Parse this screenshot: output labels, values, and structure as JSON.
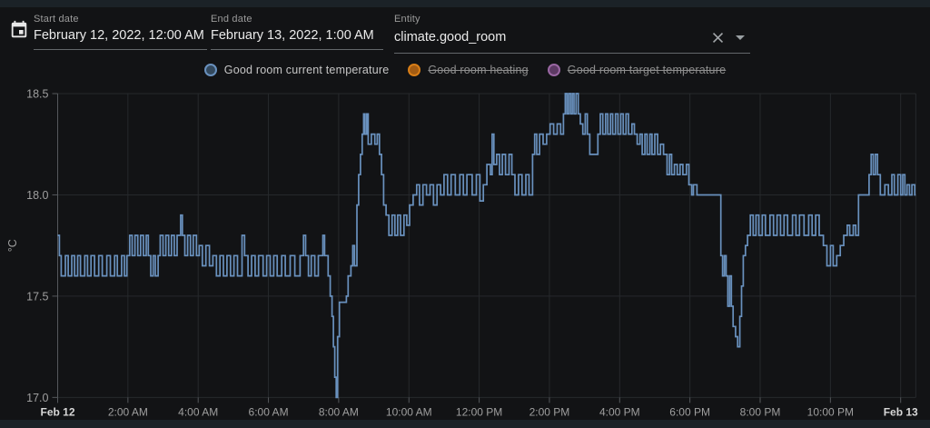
{
  "header": {
    "fields": [
      {
        "label": "Start date",
        "value": "February 12, 2022, 12:00 AM"
      },
      {
        "label": "End date",
        "value": "February 13, 2022, 1:00 AM"
      },
      {
        "label": "Entity",
        "value": "climate.good_room"
      }
    ]
  },
  "legend": [
    {
      "label": "Good room current temperature",
      "color": "#6991be",
      "fill": "#33495e",
      "active": true
    },
    {
      "label": "Good room heating",
      "color": "#d87e17",
      "fill": "#a35c13",
      "active": false
    },
    {
      "label": "Good room target temperature",
      "color": "#9a67a3",
      "fill": "#5d3a64",
      "active": false
    }
  ],
  "chart_data": {
    "type": "line",
    "line_style": "step-after",
    "series": [
      {
        "name": "Good room current temperature",
        "unit": "°C"
      }
    ],
    "ylabel": "°C",
    "ylim": [
      17.0,
      18.5
    ],
    "xlim_hours": [
      0,
      24.43
    ],
    "grid": true,
    "colors": {
      "line": "#6991be",
      "grid": "#26292c",
      "axis": "#55585c",
      "tick_label": "#9f9f9f",
      "tick_label_bold": "#d8d8d8"
    },
    "y_ticks": [
      {
        "value": 18.5,
        "label": "18.5"
      },
      {
        "value": 18.0,
        "label": "18.0"
      },
      {
        "value": 17.5,
        "label": "17.5"
      },
      {
        "value": 17.0,
        "label": "17.0"
      }
    ],
    "x_ticks": [
      {
        "hour": 0,
        "label": "Feb 12",
        "bold": true
      },
      {
        "hour": 2,
        "label": "2:00 AM",
        "bold": false
      },
      {
        "hour": 4,
        "label": "4:00 AM",
        "bold": false
      },
      {
        "hour": 6,
        "label": "6:00 AM",
        "bold": false
      },
      {
        "hour": 8,
        "label": "8:00 AM",
        "bold": false
      },
      {
        "hour": 10,
        "label": "10:00 AM",
        "bold": false
      },
      {
        "hour": 12,
        "label": "12:00 PM",
        "bold": false
      },
      {
        "hour": 14,
        "label": "2:00 PM",
        "bold": false
      },
      {
        "hour": 16,
        "label": "4:00 PM",
        "bold": false
      },
      {
        "hour": 18,
        "label": "6:00 PM",
        "bold": false
      },
      {
        "hour": 20,
        "label": "8:00 PM",
        "bold": false
      },
      {
        "hour": 22,
        "label": "10:00 PM",
        "bold": false
      },
      {
        "hour": 24,
        "label": "Feb 13",
        "bold": true
      }
    ],
    "points": [
      [
        0.0,
        17.8
      ],
      [
        0.05,
        17.7
      ],
      [
        0.1,
        17.6
      ],
      [
        0.22,
        17.7
      ],
      [
        0.3,
        17.6
      ],
      [
        0.4,
        17.7
      ],
      [
        0.48,
        17.6
      ],
      [
        0.57,
        17.7
      ],
      [
        0.65,
        17.6
      ],
      [
        0.77,
        17.7
      ],
      [
        0.85,
        17.6
      ],
      [
        0.95,
        17.7
      ],
      [
        1.05,
        17.6
      ],
      [
        1.17,
        17.7
      ],
      [
        1.27,
        17.6
      ],
      [
        1.4,
        17.7
      ],
      [
        1.5,
        17.6
      ],
      [
        1.62,
        17.7
      ],
      [
        1.7,
        17.6
      ],
      [
        1.82,
        17.7
      ],
      [
        1.9,
        17.6
      ],
      [
        1.97,
        17.7
      ],
      [
        2.05,
        17.8
      ],
      [
        2.12,
        17.7
      ],
      [
        2.2,
        17.8
      ],
      [
        2.28,
        17.7
      ],
      [
        2.36,
        17.8
      ],
      [
        2.44,
        17.7
      ],
      [
        2.52,
        17.8
      ],
      [
        2.58,
        17.7
      ],
      [
        2.65,
        17.6
      ],
      [
        2.72,
        17.7
      ],
      [
        2.78,
        17.6
      ],
      [
        2.86,
        17.7
      ],
      [
        2.92,
        17.8
      ],
      [
        3.0,
        17.7
      ],
      [
        3.08,
        17.8
      ],
      [
        3.16,
        17.7
      ],
      [
        3.24,
        17.8
      ],
      [
        3.32,
        17.7
      ],
      [
        3.4,
        17.8
      ],
      [
        3.5,
        17.9
      ],
      [
        3.55,
        17.8
      ],
      [
        3.62,
        17.7
      ],
      [
        3.7,
        17.8
      ],
      [
        3.78,
        17.7
      ],
      [
        3.86,
        17.8
      ],
      [
        3.95,
        17.7
      ],
      [
        4.03,
        17.75
      ],
      [
        4.12,
        17.65
      ],
      [
        4.22,
        17.75
      ],
      [
        4.32,
        17.65
      ],
      [
        4.42,
        17.7
      ],
      [
        4.52,
        17.6
      ],
      [
        4.62,
        17.7
      ],
      [
        4.72,
        17.6
      ],
      [
        4.82,
        17.7
      ],
      [
        4.92,
        17.6
      ],
      [
        5.02,
        17.7
      ],
      [
        5.12,
        17.6
      ],
      [
        5.25,
        17.8
      ],
      [
        5.32,
        17.7
      ],
      [
        5.42,
        17.6
      ],
      [
        5.52,
        17.7
      ],
      [
        5.62,
        17.6
      ],
      [
        5.72,
        17.7
      ],
      [
        5.85,
        17.6
      ],
      [
        5.95,
        17.7
      ],
      [
        6.05,
        17.6
      ],
      [
        6.15,
        17.7
      ],
      [
        6.25,
        17.6
      ],
      [
        6.38,
        17.7
      ],
      [
        6.48,
        17.6
      ],
      [
        6.62,
        17.7
      ],
      [
        6.75,
        17.6
      ],
      [
        6.9,
        17.7
      ],
      [
        7.0,
        17.8
      ],
      [
        7.06,
        17.7
      ],
      [
        7.14,
        17.6
      ],
      [
        7.22,
        17.7
      ],
      [
        7.32,
        17.6
      ],
      [
        7.42,
        17.7
      ],
      [
        7.55,
        17.8
      ],
      [
        7.6,
        17.7
      ],
      [
        7.7,
        17.6
      ],
      [
        7.76,
        17.5
      ],
      [
        7.81,
        17.4
      ],
      [
        7.85,
        17.25
      ],
      [
        7.89,
        17.1
      ],
      [
        7.93,
        17.0
      ],
      [
        7.97,
        17.3
      ],
      [
        8.02,
        17.47
      ],
      [
        8.22,
        17.5
      ],
      [
        8.27,
        17.6
      ],
      [
        8.35,
        17.65
      ],
      [
        8.4,
        17.75
      ],
      [
        8.45,
        17.65
      ],
      [
        8.52,
        17.95
      ],
      [
        8.57,
        18.1
      ],
      [
        8.62,
        18.2
      ],
      [
        8.67,
        18.3
      ],
      [
        8.71,
        18.4
      ],
      [
        8.75,
        18.3
      ],
      [
        8.8,
        18.4
      ],
      [
        8.84,
        18.25
      ],
      [
        8.93,
        18.3
      ],
      [
        9.03,
        18.25
      ],
      [
        9.1,
        18.3
      ],
      [
        9.16,
        18.2
      ],
      [
        9.22,
        18.1
      ],
      [
        9.28,
        17.95
      ],
      [
        9.35,
        17.9
      ],
      [
        9.43,
        17.8
      ],
      [
        9.52,
        17.9
      ],
      [
        9.6,
        17.8
      ],
      [
        9.68,
        17.9
      ],
      [
        9.76,
        17.8
      ],
      [
        9.86,
        17.9
      ],
      [
        9.94,
        17.85
      ],
      [
        10.02,
        17.95
      ],
      [
        10.12,
        18.0
      ],
      [
        10.22,
        18.05
      ],
      [
        10.3,
        17.95
      ],
      [
        10.4,
        18.05
      ],
      [
        10.5,
        18.0
      ],
      [
        10.6,
        18.05
      ],
      [
        10.7,
        17.95
      ],
      [
        10.8,
        18.05
      ],
      [
        10.9,
        18.0
      ],
      [
        11.0,
        18.1
      ],
      [
        11.1,
        18.0
      ],
      [
        11.2,
        18.1
      ],
      [
        11.32,
        18.0
      ],
      [
        11.45,
        18.1
      ],
      [
        11.55,
        18.0
      ],
      [
        11.65,
        18.1
      ],
      [
        11.8,
        18.0
      ],
      [
        11.92,
        18.1
      ],
      [
        12.02,
        17.97
      ],
      [
        12.12,
        18.05
      ],
      [
        12.22,
        18.15
      ],
      [
        12.32,
        18.1
      ],
      [
        12.37,
        18.3
      ],
      [
        12.42,
        18.15
      ],
      [
        12.5,
        18.2
      ],
      [
        12.58,
        18.1
      ],
      [
        12.66,
        18.2
      ],
      [
        12.75,
        18.1
      ],
      [
        12.85,
        18.2
      ],
      [
        12.93,
        18.1
      ],
      [
        13.02,
        18.0
      ],
      [
        13.12,
        18.1
      ],
      [
        13.22,
        18.0
      ],
      [
        13.33,
        18.1
      ],
      [
        13.42,
        18.0
      ],
      [
        13.52,
        18.2
      ],
      [
        13.58,
        18.3
      ],
      [
        13.64,
        18.2
      ],
      [
        13.72,
        18.3
      ],
      [
        13.82,
        18.25
      ],
      [
        13.92,
        18.3
      ],
      [
        14.02,
        18.35
      ],
      [
        14.12,
        18.3
      ],
      [
        14.22,
        18.35
      ],
      [
        14.32,
        18.3
      ],
      [
        14.4,
        18.4
      ],
      [
        14.45,
        18.5
      ],
      [
        14.5,
        18.4
      ],
      [
        14.55,
        18.5
      ],
      [
        14.6,
        18.4
      ],
      [
        14.65,
        18.5
      ],
      [
        14.7,
        18.4
      ],
      [
        14.76,
        18.5
      ],
      [
        14.82,
        18.4
      ],
      [
        14.88,
        18.35
      ],
      [
        14.95,
        18.3
      ],
      [
        15.02,
        18.4
      ],
      [
        15.08,
        18.3
      ],
      [
        15.15,
        18.2
      ],
      [
        15.38,
        18.3
      ],
      [
        15.45,
        18.4
      ],
      [
        15.52,
        18.3
      ],
      [
        15.6,
        18.4
      ],
      [
        15.66,
        18.3
      ],
      [
        15.74,
        18.4
      ],
      [
        15.8,
        18.3
      ],
      [
        15.88,
        18.4
      ],
      [
        15.95,
        18.3
      ],
      [
        16.03,
        18.4
      ],
      [
        16.1,
        18.3
      ],
      [
        16.18,
        18.4
      ],
      [
        16.25,
        18.3
      ],
      [
        16.35,
        18.35
      ],
      [
        16.42,
        18.3
      ],
      [
        16.5,
        18.25
      ],
      [
        16.58,
        18.3
      ],
      [
        16.64,
        18.2
      ],
      [
        16.72,
        18.3
      ],
      [
        16.78,
        18.2
      ],
      [
        16.86,
        18.3
      ],
      [
        16.92,
        18.2
      ],
      [
        17.0,
        18.3
      ],
      [
        17.08,
        18.2
      ],
      [
        17.16,
        18.25
      ],
      [
        17.25,
        18.2
      ],
      [
        17.35,
        18.1
      ],
      [
        17.42,
        18.2
      ],
      [
        17.48,
        18.1
      ],
      [
        17.56,
        18.15
      ],
      [
        17.64,
        18.1
      ],
      [
        17.72,
        18.15
      ],
      [
        17.8,
        18.1
      ],
      [
        17.9,
        18.15
      ],
      [
        17.97,
        18.05
      ],
      [
        18.05,
        18.0
      ],
      [
        18.1,
        18.05
      ],
      [
        18.2,
        18.0
      ],
      [
        18.88,
        17.7
      ],
      [
        18.93,
        17.6
      ],
      [
        18.98,
        17.7
      ],
      [
        19.03,
        17.6
      ],
      [
        19.08,
        17.45
      ],
      [
        19.13,
        17.6
      ],
      [
        19.18,
        17.45
      ],
      [
        19.23,
        17.35
      ],
      [
        19.3,
        17.3
      ],
      [
        19.36,
        17.25
      ],
      [
        19.42,
        17.4
      ],
      [
        19.47,
        17.55
      ],
      [
        19.52,
        17.7
      ],
      [
        19.58,
        17.75
      ],
      [
        19.64,
        17.8
      ],
      [
        19.72,
        17.9
      ],
      [
        19.8,
        17.8
      ],
      [
        19.88,
        17.9
      ],
      [
        19.96,
        17.8
      ],
      [
        20.06,
        17.9
      ],
      [
        20.15,
        17.8
      ],
      [
        20.28,
        17.9
      ],
      [
        20.38,
        17.8
      ],
      [
        20.48,
        17.9
      ],
      [
        20.58,
        17.8
      ],
      [
        20.68,
        17.9
      ],
      [
        20.78,
        17.8
      ],
      [
        20.92,
        17.9
      ],
      [
        21.02,
        17.8
      ],
      [
        21.12,
        17.9
      ],
      [
        21.25,
        17.8
      ],
      [
        21.38,
        17.9
      ],
      [
        21.48,
        17.8
      ],
      [
        21.58,
        17.9
      ],
      [
        21.68,
        17.8
      ],
      [
        21.8,
        17.75
      ],
      [
        21.9,
        17.65
      ],
      [
        22.0,
        17.75
      ],
      [
        22.08,
        17.65
      ],
      [
        22.18,
        17.7
      ],
      [
        22.28,
        17.75
      ],
      [
        22.38,
        17.8
      ],
      [
        22.48,
        17.85
      ],
      [
        22.55,
        17.8
      ],
      [
        22.65,
        17.85
      ],
      [
        22.72,
        17.8
      ],
      [
        22.8,
        18.0
      ],
      [
        23.1,
        18.1
      ],
      [
        23.16,
        18.2
      ],
      [
        23.22,
        18.1
      ],
      [
        23.28,
        18.2
      ],
      [
        23.34,
        18.1
      ],
      [
        23.42,
        18.0
      ],
      [
        23.55,
        18.05
      ],
      [
        23.65,
        18.0
      ],
      [
        23.75,
        18.1
      ],
      [
        23.82,
        18.0
      ],
      [
        23.92,
        18.1
      ],
      [
        24.0,
        18.0
      ],
      [
        24.06,
        18.1
      ],
      [
        24.12,
        18.0
      ],
      [
        24.18,
        18.05
      ],
      [
        24.25,
        18.0
      ],
      [
        24.32,
        18.05
      ],
      [
        24.4,
        18.0
      ]
    ]
  }
}
